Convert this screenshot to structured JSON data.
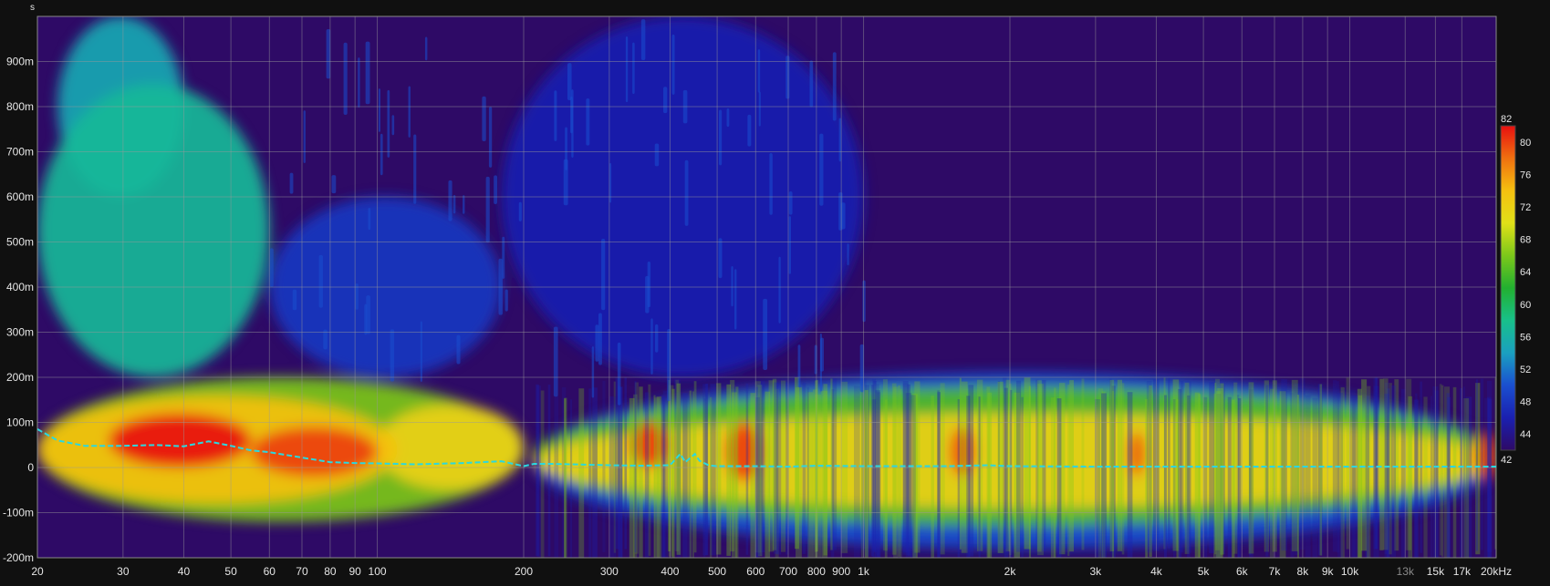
{
  "chart_data": {
    "type": "heatmap",
    "subtype": "spectrogram",
    "title": "",
    "xlabel": "",
    "ylabel": "s",
    "x_scale": "log",
    "x_unit": "Hz",
    "x_unit_label": "kHz",
    "xlim": [
      20,
      20000
    ],
    "ylim": [
      -0.2,
      1.0
    ],
    "grid": true,
    "x_ticks": [
      {
        "value": 20,
        "label": "20"
      },
      {
        "value": 30,
        "label": "30"
      },
      {
        "value": 40,
        "label": "40"
      },
      {
        "value": 50,
        "label": "50"
      },
      {
        "value": 60,
        "label": "60"
      },
      {
        "value": 70,
        "label": "70"
      },
      {
        "value": 80,
        "label": "80"
      },
      {
        "value": 90,
        "label": "90"
      },
      {
        "value": 100,
        "label": "100"
      },
      {
        "value": 200,
        "label": "200"
      },
      {
        "value": 300,
        "label": "300"
      },
      {
        "value": 400,
        "label": "400"
      },
      {
        "value": 500,
        "label": "500"
      },
      {
        "value": 600,
        "label": "600"
      },
      {
        "value": 700,
        "label": "700"
      },
      {
        "value": 800,
        "label": "800"
      },
      {
        "value": 900,
        "label": "900"
      },
      {
        "value": 1000,
        "label": "1k"
      },
      {
        "value": 2000,
        "label": "2k"
      },
      {
        "value": 3000,
        "label": "3k"
      },
      {
        "value": 4000,
        "label": "4k"
      },
      {
        "value": 5000,
        "label": "5k"
      },
      {
        "value": 6000,
        "label": "6k"
      },
      {
        "value": 7000,
        "label": "7k"
      },
      {
        "value": 8000,
        "label": "8k"
      },
      {
        "value": 9000,
        "label": "9k"
      },
      {
        "value": 10000,
        "label": "10k"
      },
      {
        "value": 13000,
        "label": "13k",
        "dim": true
      },
      {
        "value": 15000,
        "label": "15k"
      },
      {
        "value": 17000,
        "label": "17k"
      },
      {
        "value": 20000,
        "label": "20kHz"
      }
    ],
    "y_ticks": [
      {
        "value": 0.9,
        "label": "900m"
      },
      {
        "value": 0.8,
        "label": "800m"
      },
      {
        "value": 0.7,
        "label": "700m"
      },
      {
        "value": 0.6,
        "label": "600m"
      },
      {
        "value": 0.5,
        "label": "500m"
      },
      {
        "value": 0.4,
        "label": "400m"
      },
      {
        "value": 0.3,
        "label": "300m"
      },
      {
        "value": 0.2,
        "label": "200m"
      },
      {
        "value": 0.1,
        "label": "100m"
      },
      {
        "value": 0.0,
        "label": "0"
      },
      {
        "value": -0.1,
        "label": "-100m"
      },
      {
        "value": -0.2,
        "label": "-200m"
      }
    ],
    "color_scale": {
      "min": 42,
      "max": 82,
      "ticks": [
        42,
        44,
        48,
        52,
        56,
        60,
        64,
        68,
        72,
        76,
        80,
        82
      ],
      "stops": [
        {
          "value": 42,
          "color": "#2e0a66"
        },
        {
          "value": 46,
          "color": "#1a20b0"
        },
        {
          "value": 50,
          "color": "#1a4fd0"
        },
        {
          "value": 54,
          "color": "#1aa0c0"
        },
        {
          "value": 58,
          "color": "#18c08a"
        },
        {
          "value": 62,
          "color": "#22b030"
        },
        {
          "value": 66,
          "color": "#7cc81a"
        },
        {
          "value": 70,
          "color": "#e0e018"
        },
        {
          "value": 74,
          "color": "#f5c010"
        },
        {
          "value": 78,
          "color": "#f07010"
        },
        {
          "value": 82,
          "color": "#e81010"
        }
      ]
    },
    "background_color": "#2e0a66",
    "peak_line": {
      "color": "#2ad8e0",
      "style": "dashed",
      "x": [
        20,
        22,
        25,
        30,
        35,
        40,
        45,
        50,
        55,
        60,
        70,
        80,
        90,
        100,
        120,
        150,
        180,
        200,
        210,
        230,
        300,
        350,
        400,
        420,
        430,
        450,
        460,
        480,
        500,
        600,
        700,
        800,
        1000,
        1500,
        1800,
        2000,
        3000,
        5000,
        10000,
        20000
      ],
      "y": [
        0.085,
        0.06,
        0.048,
        0.048,
        0.05,
        0.047,
        0.058,
        0.048,
        0.038,
        0.034,
        0.022,
        0.012,
        0.01,
        0.009,
        0.007,
        0.01,
        0.014,
        0.003,
        0.008,
        0.008,
        0.005,
        0.004,
        0.005,
        0.03,
        0.012,
        0.03,
        0.015,
        0.005,
        0.003,
        0.003,
        0.002,
        0.004,
        0.003,
        0.003,
        0.005,
        0.003,
        0.002,
        0.002,
        0.002,
        0.002
      ]
    },
    "energy_regions": [
      {
        "f1": 28,
        "f2": 55,
        "t1": 0.0,
        "t2": 0.12,
        "level": 82
      },
      {
        "f1": 55,
        "f2": 100,
        "t1": -0.02,
        "t2": 0.09,
        "level": 80
      },
      {
        "f1": 20,
        "f2": 110,
        "t1": -0.08,
        "t2": 0.16,
        "level": 74
      },
      {
        "f1": 20,
        "f2": 200,
        "t1": -0.12,
        "t2": 0.2,
        "level": 66
      },
      {
        "f1": 100,
        "f2": 200,
        "t1": -0.05,
        "t2": 0.14,
        "level": 72
      },
      {
        "f1": 20,
        "f2": 60,
        "t1": 0.2,
        "t2": 0.85,
        "level": 57
      },
      {
        "f1": 22,
        "f2": 40,
        "t1": 0.6,
        "t2": 1.0,
        "level": 55
      },
      {
        "f1": 60,
        "f2": 180,
        "t1": 0.2,
        "t2": 0.6,
        "level": 48
      },
      {
        "f1": 180,
        "f2": 1000,
        "t1": 0.2,
        "t2": 1.0,
        "level": 46
      },
      {
        "f1": 210,
        "f2": 20000,
        "t1": -0.09,
        "t2": 0.12,
        "level": 72
      },
      {
        "f1": 210,
        "f2": 20000,
        "t1": -0.13,
        "t2": 0.18,
        "level": 64
      },
      {
        "f1": 210,
        "f2": 20000,
        "t1": -0.18,
        "t2": 0.21,
        "level": 50
      },
      {
        "f1": 330,
        "f2": 400,
        "t1": 0.0,
        "t2": 0.1,
        "level": 80
      },
      {
        "f1": 520,
        "f2": 620,
        "t1": -0.03,
        "t2": 0.1,
        "level": 80
      },
      {
        "f1": 1500,
        "f2": 1700,
        "t1": -0.02,
        "t2": 0.09,
        "level": 79
      },
      {
        "f1": 3500,
        "f2": 3800,
        "t1": -0.02,
        "t2": 0.08,
        "level": 79
      },
      {
        "f1": 18000,
        "f2": 20000,
        "t1": -0.03,
        "t2": 0.08,
        "level": 80
      }
    ]
  }
}
